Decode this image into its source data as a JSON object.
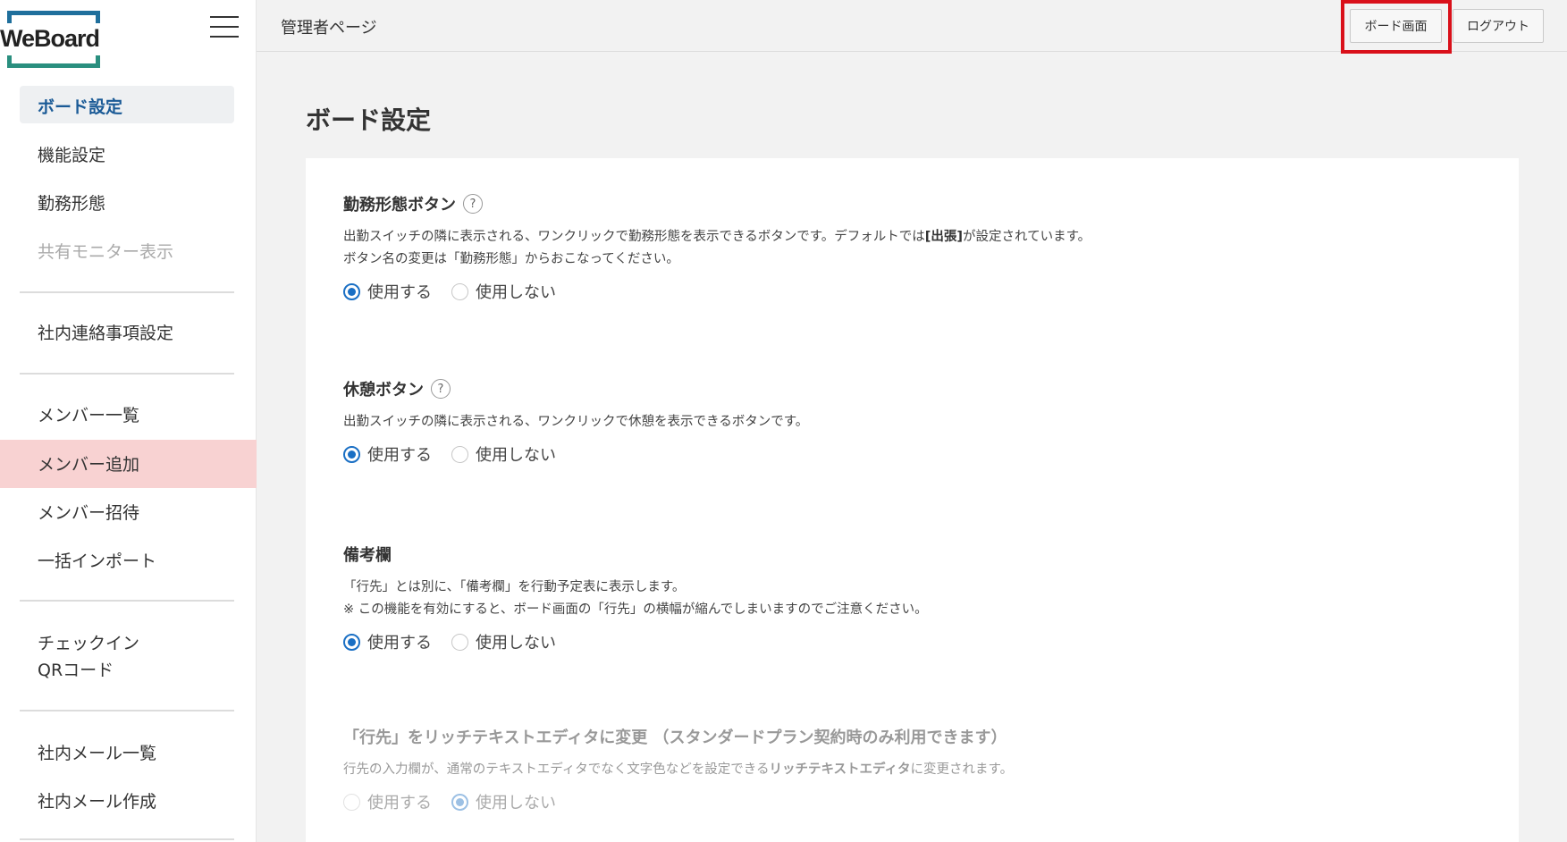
{
  "brand": {
    "name": "WeBoard"
  },
  "sidebar": {
    "items": [
      {
        "label": "ボード設定"
      },
      {
        "label": "機能設定"
      },
      {
        "label": "勤務形態"
      },
      {
        "label": "共有モニター表示"
      },
      {
        "label": "社内連絡事項設定"
      },
      {
        "label": "メンバー一覧"
      },
      {
        "label": "メンバー追加"
      },
      {
        "label": "メンバー招待"
      },
      {
        "label": "一括インポート"
      },
      {
        "label": "チェックイン"
      },
      {
        "label": "QRコード"
      },
      {
        "label": "社内メール一覧"
      },
      {
        "label": "社内メール作成"
      }
    ]
  },
  "header": {
    "page_label": "管理者ページ",
    "board_button": "ボード画面",
    "logout_button": "ログアウト"
  },
  "main": {
    "title": "ボード設定",
    "sections": [
      {
        "title": "勤務形態ボタン",
        "help": "?",
        "desc_pre": "出勤スイッチの隣に表示される、ワンクリックで勤務形態を表示できるボタンです。デフォルトでは",
        "desc_bold": "[出張]",
        "desc_post": "が設定されています。",
        "desc_line2": "ボタン名の変更は「勤務形態」からおこなってください。",
        "options": [
          "使用する",
          "使用しない"
        ],
        "selected": "使用する"
      },
      {
        "title": "休憩ボタン",
        "help": "?",
        "desc_line1": "出勤スイッチの隣に表示される、ワンクリックで休憩を表示できるボタンです。",
        "options": [
          "使用する",
          "使用しない"
        ],
        "selected": "使用する"
      },
      {
        "title": "備考欄",
        "desc_line1": "「行先」とは別に、「備考欄」を行動予定表に表示します。",
        "desc_line2": "※ この機能を有効にすると、ボード画面の「行先」の横幅が縮んでしまいますのでご注意ください。",
        "options": [
          "使用する",
          "使用しない"
        ],
        "selected": "使用する"
      },
      {
        "title": "「行先」をリッチテキストエディタに変更 （スタンダードプラン契約時のみ利用できます）",
        "desc_pre": "行先の入力欄が、通常のテキストエディタでなく文字色などを設定できる",
        "desc_bold": "リッチテキストエディタ",
        "desc_post": "に変更されます。",
        "options": [
          "使用する",
          "使用しない"
        ],
        "selected": "使用しない",
        "disabled": true
      }
    ]
  },
  "colors": {
    "accent": "#1a6fc4",
    "active_nav_text": "#1a5a96",
    "highlight_row": "#f8d2d2",
    "annotation_frame": "#d9101a"
  }
}
